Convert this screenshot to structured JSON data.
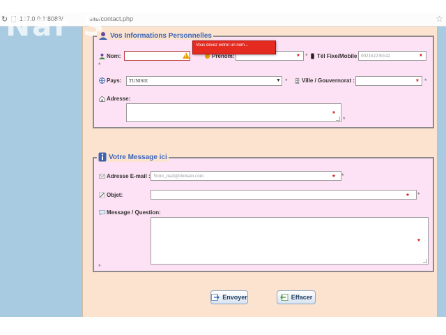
{
  "browser": {
    "url_host": "127.0.0.1:8083/",
    "url_path": "site/contact.php"
  },
  "watermark": "Nar   S",
  "personal": {
    "legend": "Vos Informations Personnelles",
    "nom_label": "Nom:",
    "nom_value": "",
    "prenom_label": "Prénom:",
    "prenom_value": "",
    "tel_label": "Tél Fixe/Mobile :",
    "tel_value": "002162236542",
    "pays_label": "Pays:",
    "pays_value": "TUNISIE",
    "ville_label": "Ville / Gouvernorat :",
    "ville_value": "",
    "adresse_label": "Adresse:",
    "error_tooltip": "Vous devez entrer un nom..."
  },
  "message": {
    "legend": "Votre Message ici",
    "email_label": "Adresse E-mail :",
    "email_placeholder": "Votre_mail@domain.com",
    "objet_label": "Objet:",
    "objet_value": "",
    "message_label": "Message / Question:"
  },
  "buttons": {
    "send_label": "Envoyer",
    "clear_label": "Effacer"
  },
  "markers": {
    "required": "*",
    "warning": "!"
  },
  "icons": {
    "reload": "reload-icon",
    "bookmark": "star-icon",
    "user": "user-icon",
    "globe": "globe-icon",
    "phone": "phone-icon",
    "building": "building-icon",
    "home": "home-icon",
    "info": "info-icon",
    "email": "email-icon",
    "pencil": "pencil-icon",
    "message": "message-icon",
    "send": "send-icon",
    "clear": "clear-icon"
  },
  "colors": {
    "side_panel": "#a8cbe2",
    "main_bg": "#fbe3cf",
    "form_bg": "#fde1f4",
    "legend": "#3a64b8",
    "error": "#e52a20",
    "required": "#d01010"
  }
}
